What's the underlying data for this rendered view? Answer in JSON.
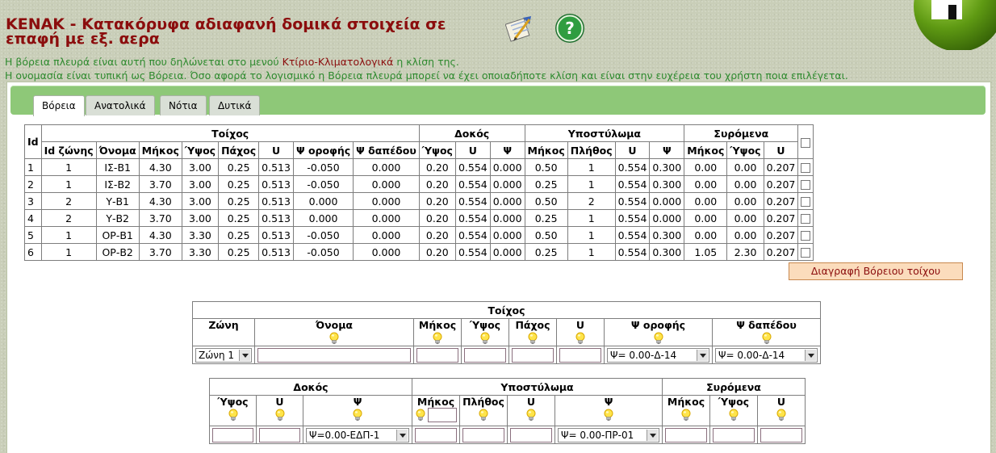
{
  "page": {
    "title_line1": "ΚΕΝΑΚ - Κατακόρυφα αδιαφανή δομικά στοιχεία σε",
    "title_line2": "επαφή με εξ. αερα",
    "info1_pre": "Η βόρεια πλευρά είναι αυτή που δηλώνεται στο μενού ",
    "info1_link": "Κτίριο-Κλιματολογικά",
    "info1_post": " η κλίση της.",
    "info2": "Η ονομασία είναι τυπική ως Βόρεια. Όσο αφορά το λογισμικό η Βόρεια πλευρά μπορεί να έχει οποιαδήποτε κλίση και είναι στην ευχέρεια του χρήστη ποια επιλέγεται."
  },
  "icons": {
    "tools": "tools-icon",
    "help": "help-icon",
    "home": "home-icon",
    "hint": "lightbulb-icon"
  },
  "colors": {
    "title": "#8b0d0d",
    "info": "#2e8a2e",
    "tabbar": "#8ec878",
    "delete_button": "#fbdcbc"
  },
  "tabs": [
    "Βόρεια",
    "Ανατολικά",
    "Νότια",
    "Δυτικά"
  ],
  "active_tab": "Βόρεια",
  "main_table": {
    "group_headers": {
      "id": "Id",
      "wall": "Τοίχος",
      "beam": "Δοκός",
      "column": "Υποστύλωμα",
      "blind": "Συρόμενα"
    },
    "columns": [
      "Id ζώνης",
      "Όνομα",
      "Μήκος",
      "Ύψος",
      "Πάχος",
      "U",
      "Ψ οροφής",
      "Ψ δαπέδου",
      "Ύψος",
      "U",
      "Ψ",
      "Μήκος",
      "Πλήθος",
      "U",
      "Ψ",
      "Μήκος",
      "Ύψος",
      "U"
    ],
    "rows": [
      [
        "1",
        "1",
        "ΙΣ-Β1",
        "4.30",
        "3.00",
        "0.25",
        "0.513",
        "-0.050",
        "0.000",
        "0.20",
        "0.554",
        "0.000",
        "0.50",
        "1",
        "0.554",
        "0.300",
        "0.00",
        "0.00",
        "0.207"
      ],
      [
        "2",
        "1",
        "ΙΣ-Β2",
        "3.70",
        "3.00",
        "0.25",
        "0.513",
        "-0.050",
        "0.000",
        "0.20",
        "0.554",
        "0.000",
        "0.25",
        "1",
        "0.554",
        "0.300",
        "0.00",
        "0.00",
        "0.207"
      ],
      [
        "3",
        "2",
        "Υ-Β1",
        "4.30",
        "3.00",
        "0.25",
        "0.513",
        "0.000",
        "0.000",
        "0.20",
        "0.554",
        "0.000",
        "0.50",
        "2",
        "0.554",
        "0.000",
        "0.00",
        "0.00",
        "0.207"
      ],
      [
        "4",
        "2",
        "Υ-Β2",
        "3.70",
        "3.00",
        "0.25",
        "0.513",
        "0.000",
        "0.000",
        "0.20",
        "0.554",
        "0.000",
        "0.25",
        "1",
        "0.554",
        "0.000",
        "0.00",
        "0.00",
        "0.207"
      ],
      [
        "5",
        "1",
        "ΟΡ-Β1",
        "4.30",
        "3.30",
        "0.25",
        "0.513",
        "-0.050",
        "0.000",
        "0.20",
        "0.554",
        "0.000",
        "0.50",
        "1",
        "0.554",
        "0.300",
        "0.00",
        "0.00",
        "0.207"
      ],
      [
        "6",
        "1",
        "ΟΡ-Β2",
        "3.70",
        "3.30",
        "0.25",
        "0.513",
        "-0.050",
        "0.000",
        "0.20",
        "0.554",
        "0.000",
        "0.25",
        "1",
        "0.554",
        "0.300",
        "1.05",
        "2.30",
        "0.207"
      ]
    ],
    "delete_button": "Διαγραφή Βόρειου τοίχου"
  },
  "form_wall": {
    "group": "Τοίχος",
    "headers": [
      "Ζώνη",
      "Όνομα",
      "Μήκος",
      "Ύψος",
      "Πάχος",
      "U",
      "Ψ οροφής",
      "Ψ δαπέδου"
    ],
    "zone_select": "Ζώνη 1",
    "psi_roof_select": "Ψ= 0.00-Δ-14",
    "psi_floor_select": "Ψ= 0.00-Δ-14"
  },
  "form_beam": {
    "groups": [
      "Δοκός",
      "Υποστύλωμα",
      "Συρόμενα"
    ],
    "headers": [
      "Ύψος",
      "U",
      "Ψ",
      "Μήκος",
      "Πλήθος",
      "U",
      "Ψ",
      "Μήκος",
      "Ύψος",
      "U"
    ],
    "beam_psi_select": "Ψ=0.00-ΕΔΠ-1",
    "column_psi_select": "Ψ= 0.00-ΠΡ-01"
  }
}
